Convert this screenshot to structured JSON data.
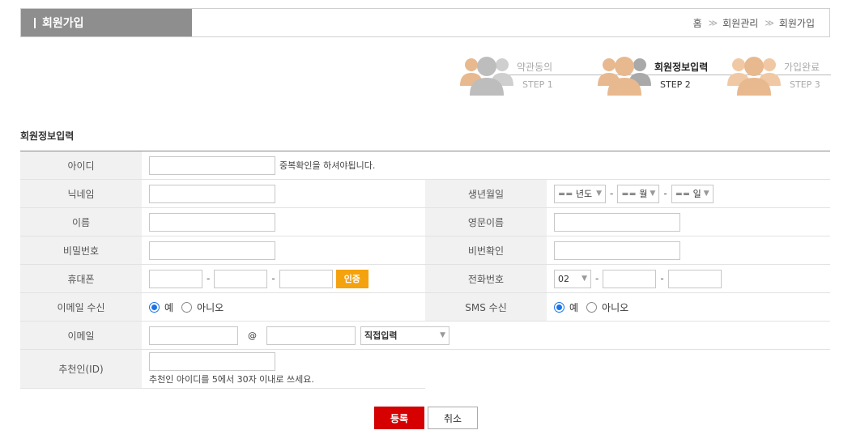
{
  "header": {
    "title": "회원가입",
    "breadcrumb": [
      "홈",
      "회원관리",
      "회원가입"
    ],
    "separator": "≫"
  },
  "steps": [
    {
      "name": "약관동의",
      "num": "STEP 1",
      "active": false
    },
    {
      "name": "회원정보입력",
      "num": "STEP 2",
      "active": true
    },
    {
      "name": "가입완료",
      "num": "STEP 3",
      "active": false
    }
  ],
  "section_title": "회원정보입력",
  "form": {
    "id_label": "아이디",
    "id_note": "중복확인을 하셔야됩니다.",
    "nickname_label": "닉네임",
    "birth_label": "생년월일",
    "birth_year": "== 년도",
    "birth_month": "== 월",
    "birth_day": "== 일",
    "name_label": "이름",
    "eng_name_label": "영문이름",
    "password_label": "비밀번호",
    "password_confirm_label": "비번확인",
    "mobile_label": "휴대폰",
    "cert_button": "인증",
    "phone_label": "전화번호",
    "phone_area": "02",
    "email_recv_label": "이메일 수신",
    "sms_recv_label": "SMS 수신",
    "yes": "예",
    "no": "아니오",
    "email_label": "이메일",
    "at": "@",
    "email_domain": "직접입력",
    "recommender_label": "추천인(ID)",
    "recommender_note": "추천인 아이디를 5에서 30자 이내로 쓰세요."
  },
  "buttons": {
    "submit": "등록",
    "cancel": "취소"
  },
  "colors": {
    "accent": "#d60000",
    "cert": "#f4a20e",
    "step_active": "#e8b98e",
    "step_inactive": "#bdbdbd"
  }
}
